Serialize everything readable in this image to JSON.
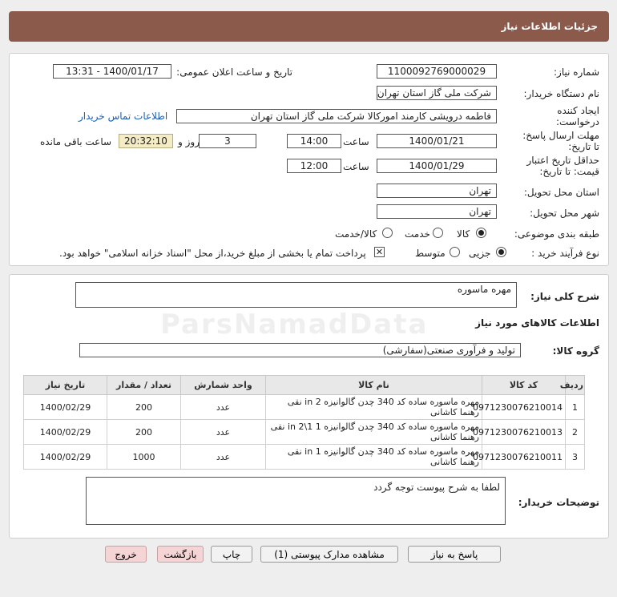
{
  "header": {
    "title": "جزئیات اطلاعات نیاز"
  },
  "form": {
    "need_number_label": "شماره نیاز:",
    "need_number": "1100092769000029",
    "announce_label": "تاریخ و ساعت اعلان عمومی:",
    "announce_value": "1400/01/17 - 13:31",
    "buyer_org_label": "نام دستگاه خریدار:",
    "buyer_org": "شرکت ملی گاز استان تهران",
    "creator_label": "ایجاد کننده درخواست:",
    "creator": "فاطمه درویشی کارمند امورکالا شرکت ملی گاز استان تهران",
    "contact_link": "اطلاعات تماس خریدار",
    "deadline_label": "مهلت ارسال پاسخ: تا تاریخ:",
    "deadline_date": "1400/01/21",
    "time_label": "ساعت",
    "deadline_time": "14:00",
    "days_value": "3",
    "days_label": "روز و",
    "remaining_time": "20:32:10",
    "remaining_label": "ساعت باقی مانده",
    "validity_label": "حداقل تاریخ اعتبار قیمت: تا تاریخ:",
    "validity_date": "1400/01/29",
    "validity_time": "12:00",
    "province_label": "استان محل تحویل:",
    "province": "تهران",
    "city_label": "شهر محل تحویل:",
    "city": "تهران",
    "category_label": "طبقه بندی موضوعی:",
    "category_options": [
      "کالا",
      "خدمت",
      "کالا/خدمت"
    ],
    "process_label": "نوع فرآیند خرید :",
    "process_options": [
      "جزیی",
      "متوسط"
    ],
    "payment_note": "پرداخت تمام یا بخشی از مبلغ خرید،از محل \"اسناد خزانه اسلامی\" خواهد بود."
  },
  "details": {
    "summary_label": "شرح کلی نیاز:",
    "summary": "مهره ماسوره",
    "goods_title": "اطلاعات کالاهای مورد نیاز",
    "group_label": "گروه کالا:",
    "group": "تولید و فرآوری صنعتی(سفارشی)",
    "columns": [
      "ردیف",
      "کد کالا",
      "نام کالا",
      "واحد شمارش",
      "تعداد / مقدار",
      "تاریخ نیاز"
    ],
    "rows": [
      {
        "idx": "1",
        "code": "0971230076210014",
        "name": "مهره ماسوره ساده کد 340 چدن گالوانیزه 2 in نقی رهنما کاشانی",
        "unit": "عدد",
        "qty": "200",
        "date": "1400/02/29"
      },
      {
        "idx": "2",
        "code": "0971230076210013",
        "name": "مهره ماسوره ساده کد 340 چدن گالوانیزه 1 1\\2 in نقی رهنما کاشانی",
        "unit": "عدد",
        "qty": "200",
        "date": "1400/02/29"
      },
      {
        "idx": "3",
        "code": "0971230076210011",
        "name": "مهره ماسوره ساده کد 340 چدن گالوانیزه 1 in نقی رهنما کاشانی",
        "unit": "عدد",
        "qty": "1000",
        "date": "1400/02/29"
      }
    ],
    "buyer_notes_label": "توضیحات خریدار:",
    "buyer_notes": "لطفا به شرح پیوست توجه گردد"
  },
  "watermark": "ParsNamadData",
  "buttons": {
    "reply": "پاسخ به نیاز",
    "docs": "مشاهده مدارک پیوستی (1)",
    "print": "چاپ",
    "back": "بازگشت",
    "exit": "خروج"
  }
}
